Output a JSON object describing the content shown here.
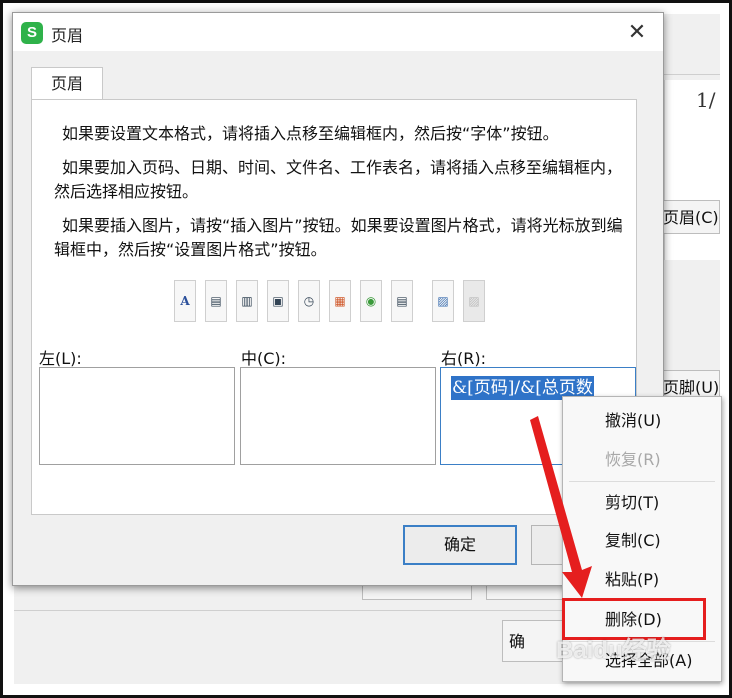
{
  "header_dialog": {
    "title": "页眉",
    "app_logo": "S",
    "tab_label": "页眉",
    "instructions": [
      "如果要设置文本格式，请将插入点移至编辑框内，然后按“字体”按钮。",
      "如果要加入页码、日期、时间、文件名、工作表名，请将插入点移至编辑框内，然后选择相应按钮。",
      "如果要插入图片，请按“插入图片”按钮。如果要设置图片格式，请将光标放到编辑框中，然后按“设置图片格式”按钮。"
    ],
    "toolbar_icons": [
      "font-icon",
      "page-number-icon",
      "total-pages-icon",
      "date-icon",
      "time-icon",
      "file-path-icon",
      "file-name-icon",
      "sheet-name-icon",
      "insert-picture-icon",
      "format-picture-icon"
    ],
    "section_labels": {
      "left": "左(L):",
      "center": "中(C):",
      "right": "右(R):"
    },
    "right_section_value": "&[页码]/&[总页数",
    "ok_label": "确定"
  },
  "background_dialog": {
    "page_indicator": "1/",
    "header_button": "页眉(C).",
    "footer_button": "页脚(U)",
    "ok_label": "确"
  },
  "context_menu": {
    "items": [
      {
        "label": "撤消(U)",
        "enabled": true
      },
      {
        "label": "恢复(R)",
        "enabled": false
      },
      {
        "label": "剪切(T)",
        "enabled": true
      },
      {
        "label": "复制(C)",
        "enabled": true
      },
      {
        "label": "粘贴(P)",
        "enabled": true
      },
      {
        "label": "删除(D)",
        "enabled": true,
        "highlighted": true
      },
      {
        "label": "选择全部(A)",
        "enabled": true
      }
    ]
  },
  "watermark": "Baidu经验",
  "colors": {
    "highlight": "#e51e1e",
    "selection": "#2f73c8",
    "app_logo": "#2fb24a"
  }
}
